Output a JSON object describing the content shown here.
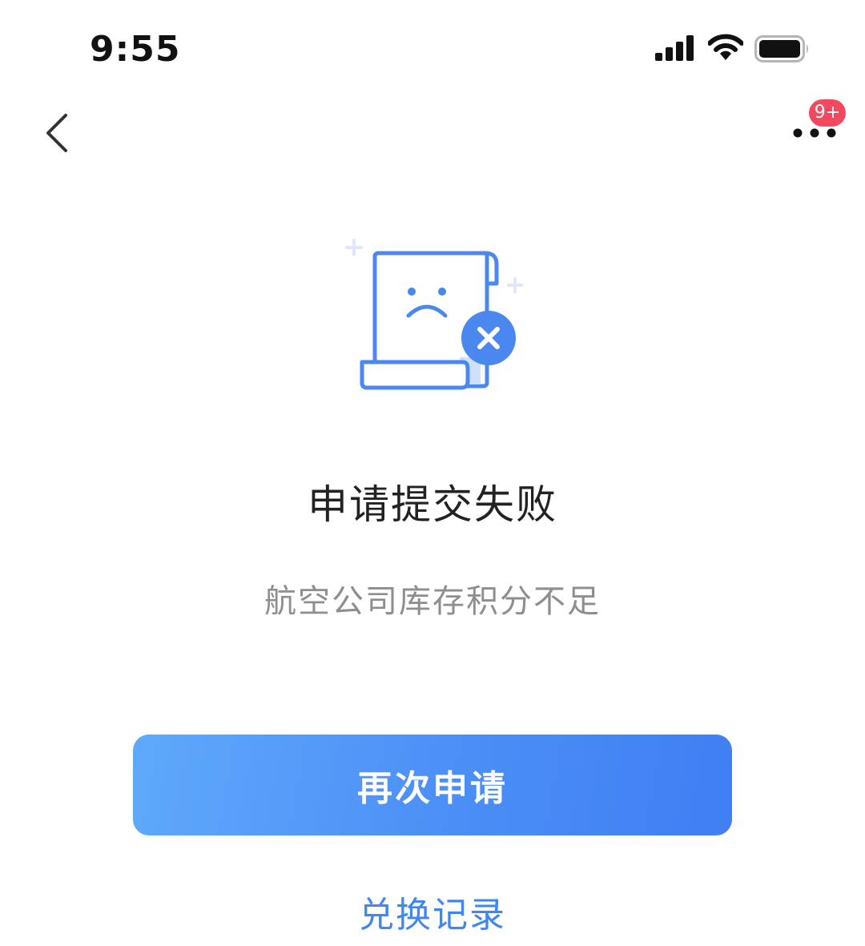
{
  "status_bar": {
    "time": "9:55",
    "icons": [
      "cellular-signal-icon",
      "wifi-icon",
      "battery-icon"
    ]
  },
  "nav": {
    "back_icon": "chevron-left-icon",
    "more_icon": "more-dots-icon",
    "badge": "9+"
  },
  "result": {
    "illustration": "failed-document-sad-face-icon",
    "title": "申请提交失败",
    "subtitle": "航空公司库存积分不足"
  },
  "actions": {
    "primary_label": "再次申请",
    "secondary_label": "兑换记录"
  },
  "colors": {
    "accent": "#4b8ef6",
    "badge": "#f2495e",
    "link": "#3e86f2"
  }
}
